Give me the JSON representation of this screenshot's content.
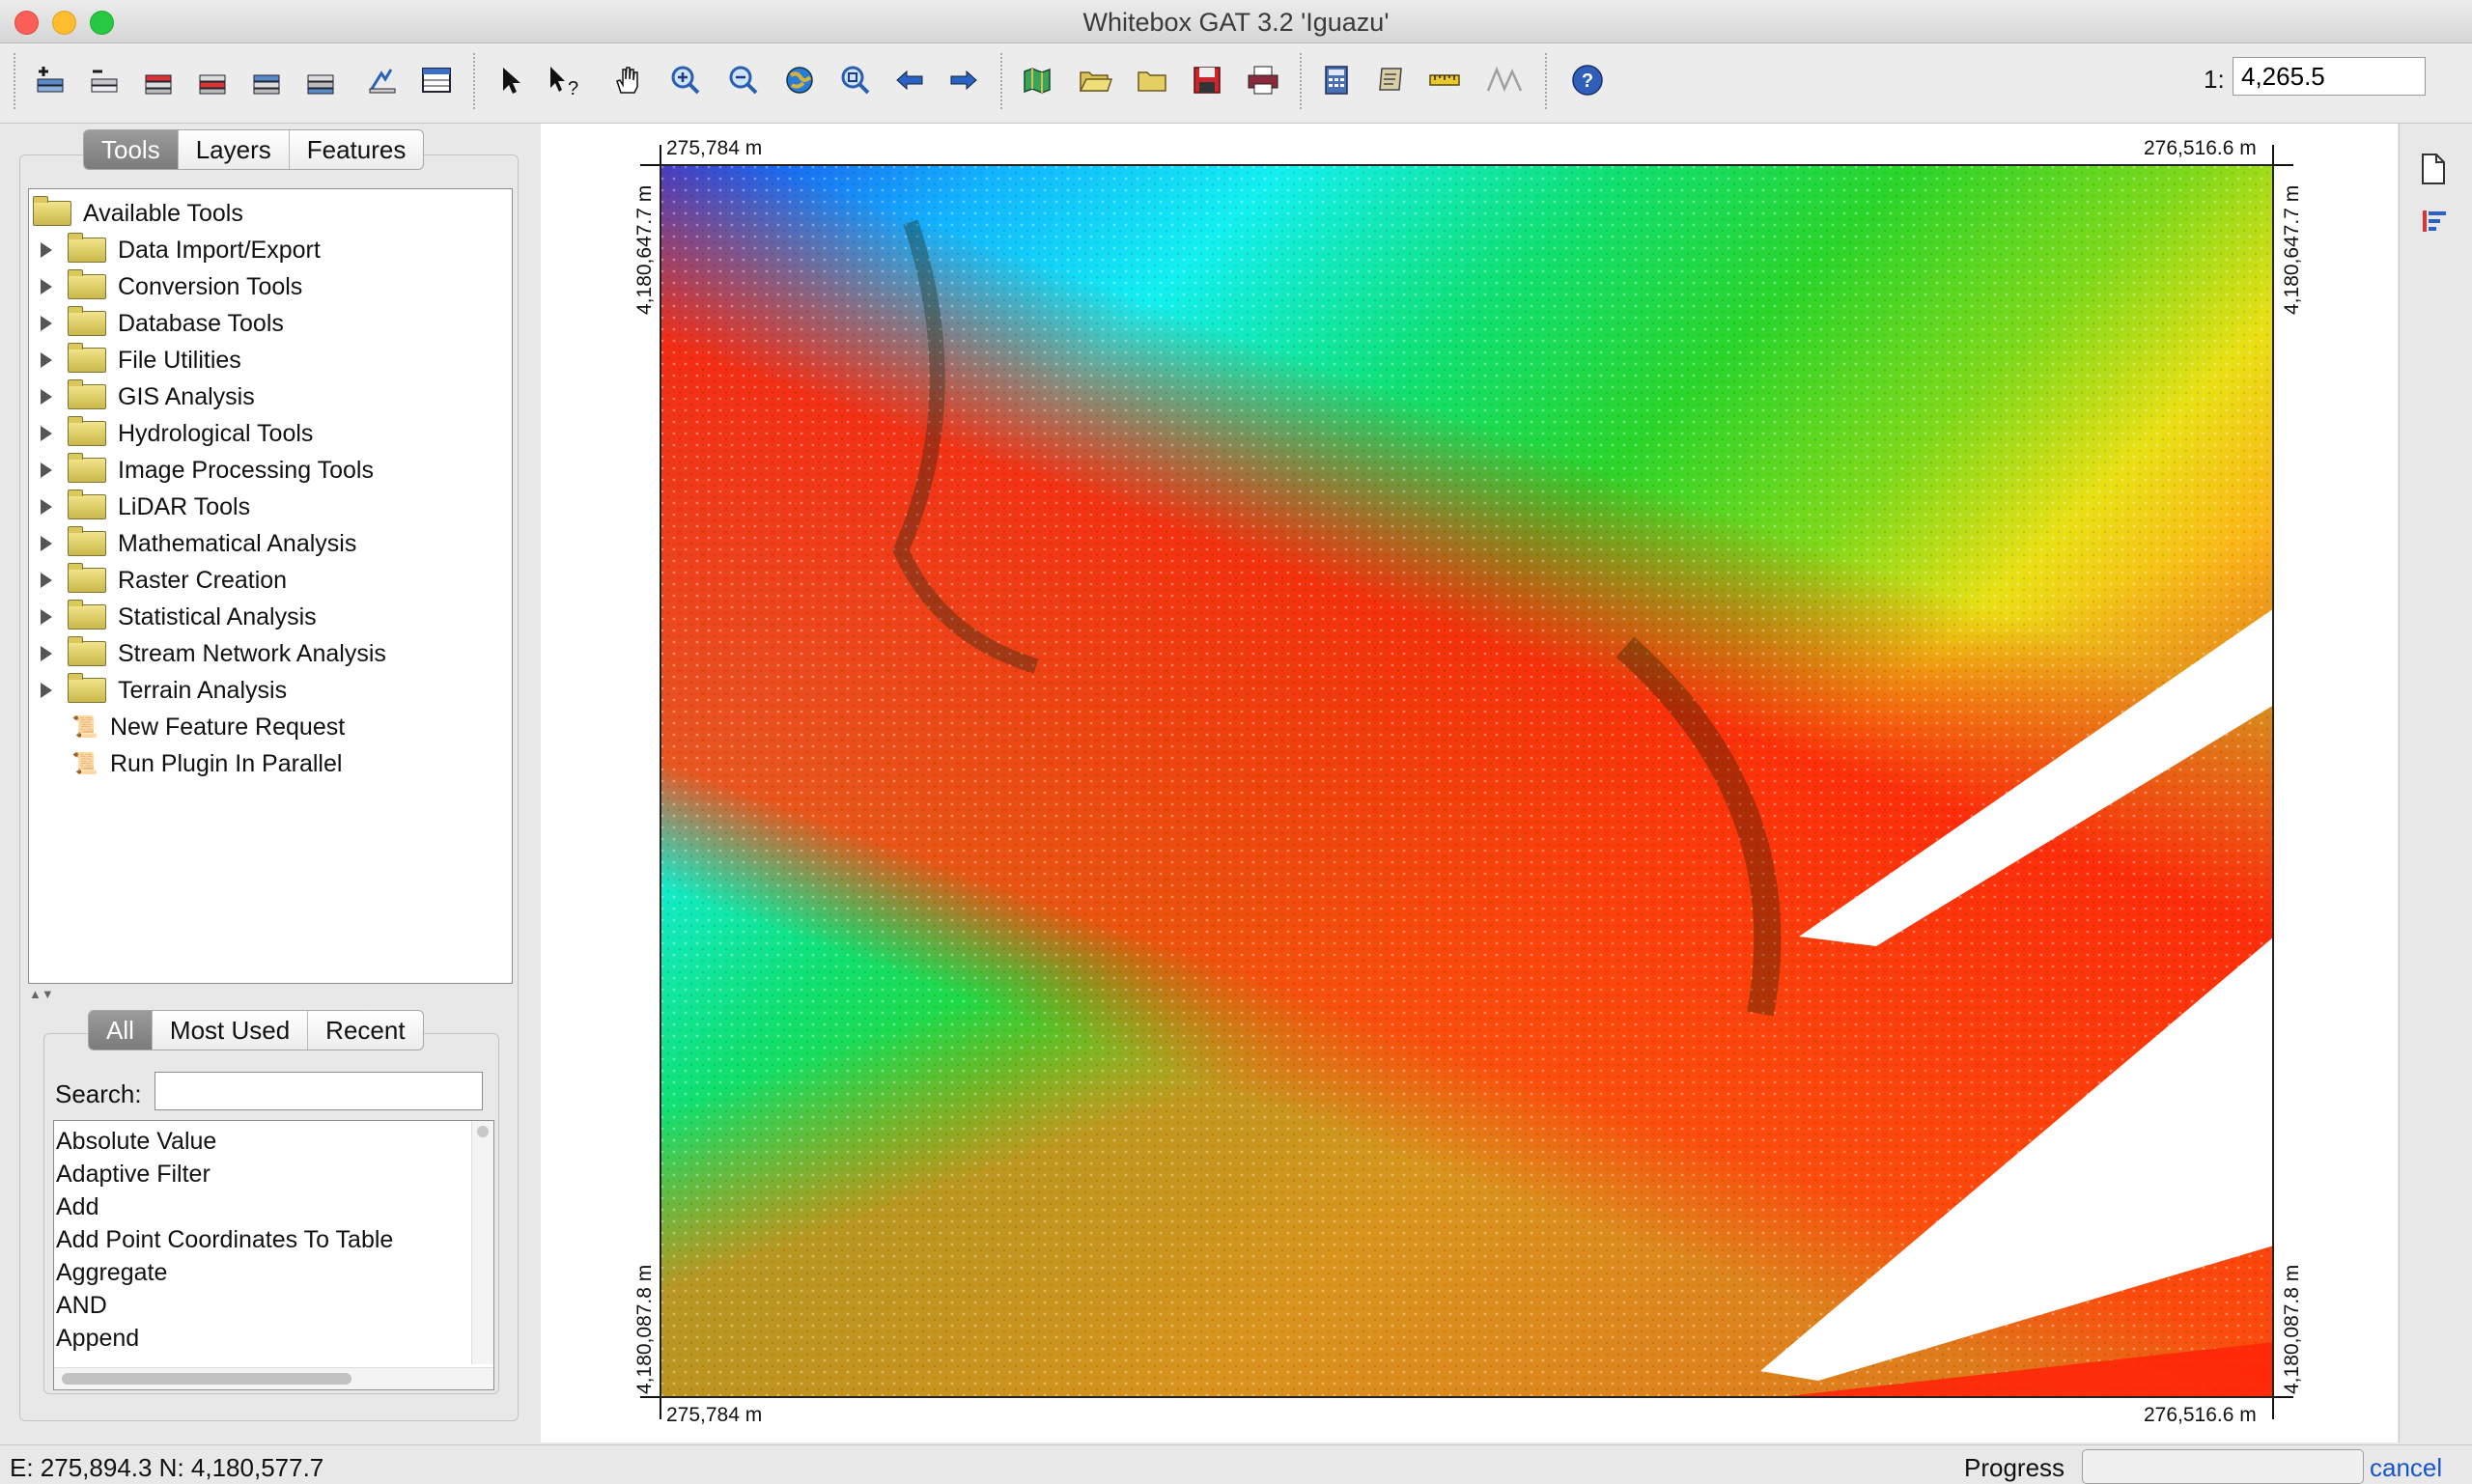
{
  "window": {
    "title": "Whitebox GAT 3.2 'Iguazu'"
  },
  "toolbar": {
    "scale_prefix": "1:",
    "scale_value": "4,265.5",
    "icons": [
      "add-layer-icon",
      "remove-layer-icon",
      "raise-layer-icon",
      "lower-layer-icon",
      "layer-to-top-icon",
      "layer-to-bottom-icon",
      "layer-properties-icon",
      "attribute-table-icon",
      "select-arrow-icon",
      "whats-this-icon",
      "pan-hand-icon",
      "zoom-in-icon",
      "zoom-out-icon",
      "zoom-full-extent-icon",
      "zoom-to-layer-icon",
      "previous-extent-icon",
      "next-extent-icon",
      "new-map-icon",
      "open-map-icon",
      "open-folder-icon",
      "save-map-icon",
      "print-map-icon",
      "raster-calculator-icon",
      "scripter-icon",
      "measure-ruler-icon",
      "digitize-line-icon",
      "help-icon"
    ]
  },
  "left_panel": {
    "tabs": [
      {
        "label": "Tools",
        "active": true
      },
      {
        "label": "Layers",
        "active": false
      },
      {
        "label": "Features",
        "active": false
      }
    ],
    "tree": {
      "root": "Available Tools",
      "folders": [
        "Data Import/Export",
        "Conversion Tools",
        "Database Tools",
        "File Utilities",
        "GIS Analysis",
        "Hydrological Tools",
        "Image Processing Tools",
        "LiDAR Tools",
        "Mathematical Analysis",
        "Raster Creation",
        "Statistical Analysis",
        "Stream Network Analysis",
        "Terrain Analysis"
      ],
      "items": [
        "New Feature Request",
        "Run Plugin In Parallel"
      ]
    },
    "list_tabs": [
      {
        "label": "All",
        "active": true
      },
      {
        "label": "Most Used",
        "active": false
      },
      {
        "label": "Recent",
        "active": false
      }
    ],
    "search": {
      "label": "Search:",
      "value": ""
    },
    "tool_list": [
      "Absolute Value",
      "Adaptive Filter",
      "Add",
      "Add Point Coordinates To Table",
      "Aggregate",
      "AND",
      "Append"
    ]
  },
  "map": {
    "x_min_label": "275,784 m",
    "x_max_label": "276,516.6 m",
    "y_max_label": "4,180,647.7 m",
    "y_min_label": "4,180,087.8 m",
    "colors": {
      "low": "#1f3fe8",
      "mid": "#2ad52a",
      "high": "#ff1f08"
    }
  },
  "statusbar": {
    "coordinates": "E: 275,894.3  N: 4,180,577.7",
    "progress_label": "Progress",
    "progress_value": 0,
    "cancel_label": "cancel"
  }
}
